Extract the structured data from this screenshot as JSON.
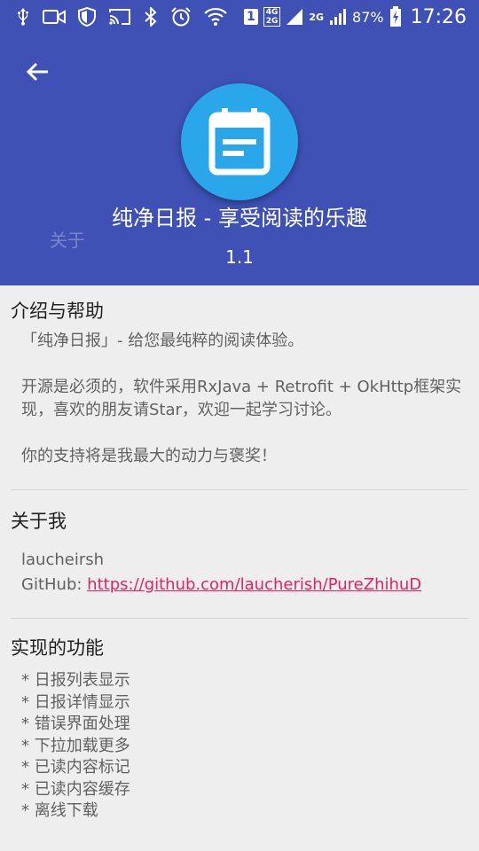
{
  "status_bar": {
    "sim_slot": "1",
    "net_top": "4G",
    "net_bottom": "2G",
    "net_second": "2G",
    "battery": "87%",
    "time": "17:26",
    "icons": [
      "usb-icon",
      "video-icon",
      "shield-icon",
      "cast-icon",
      "bluetooth-icon",
      "alarm-icon",
      "wifi-icon",
      "signal-icon",
      "battery-charging-icon"
    ]
  },
  "header": {
    "back_icon": "arrow-back-icon",
    "logo_icon": "calendar-note-icon",
    "app_name": "纯净日报 - 享受阅读的乐趣",
    "ghost_title": "关于",
    "version": "1.1",
    "colors": {
      "primary": "#3f51b5",
      "logo_bg": "#29a7ea"
    }
  },
  "sections": {
    "intro": {
      "title": "介绍与帮助",
      "p1": "「纯净日报」- 给您最纯粹的阅读体验。",
      "p2": "开源是必须的，软件采用RxJava + Retrofit + OkHttp框架实现，喜欢的朋友请Star，欢迎一起学习讨论。",
      "p3": "你的支持将是我最大的动力与褒奖！"
    },
    "about_me": {
      "title": "关于我",
      "name": "laucheirsh",
      "github_label": "GitHub: ",
      "github_link": "https://github.com/laucherish/PureZhihuD",
      "link_color": "#e91e63"
    },
    "features": {
      "title": "实现的功能",
      "items": [
        "* 日报列表显示",
        "* 日报详情显示",
        "* 错误界面处理",
        "* 下拉加载更多",
        "* 已读内容标记",
        "* 已读内容缓存",
        "* 离线下载"
      ]
    }
  }
}
